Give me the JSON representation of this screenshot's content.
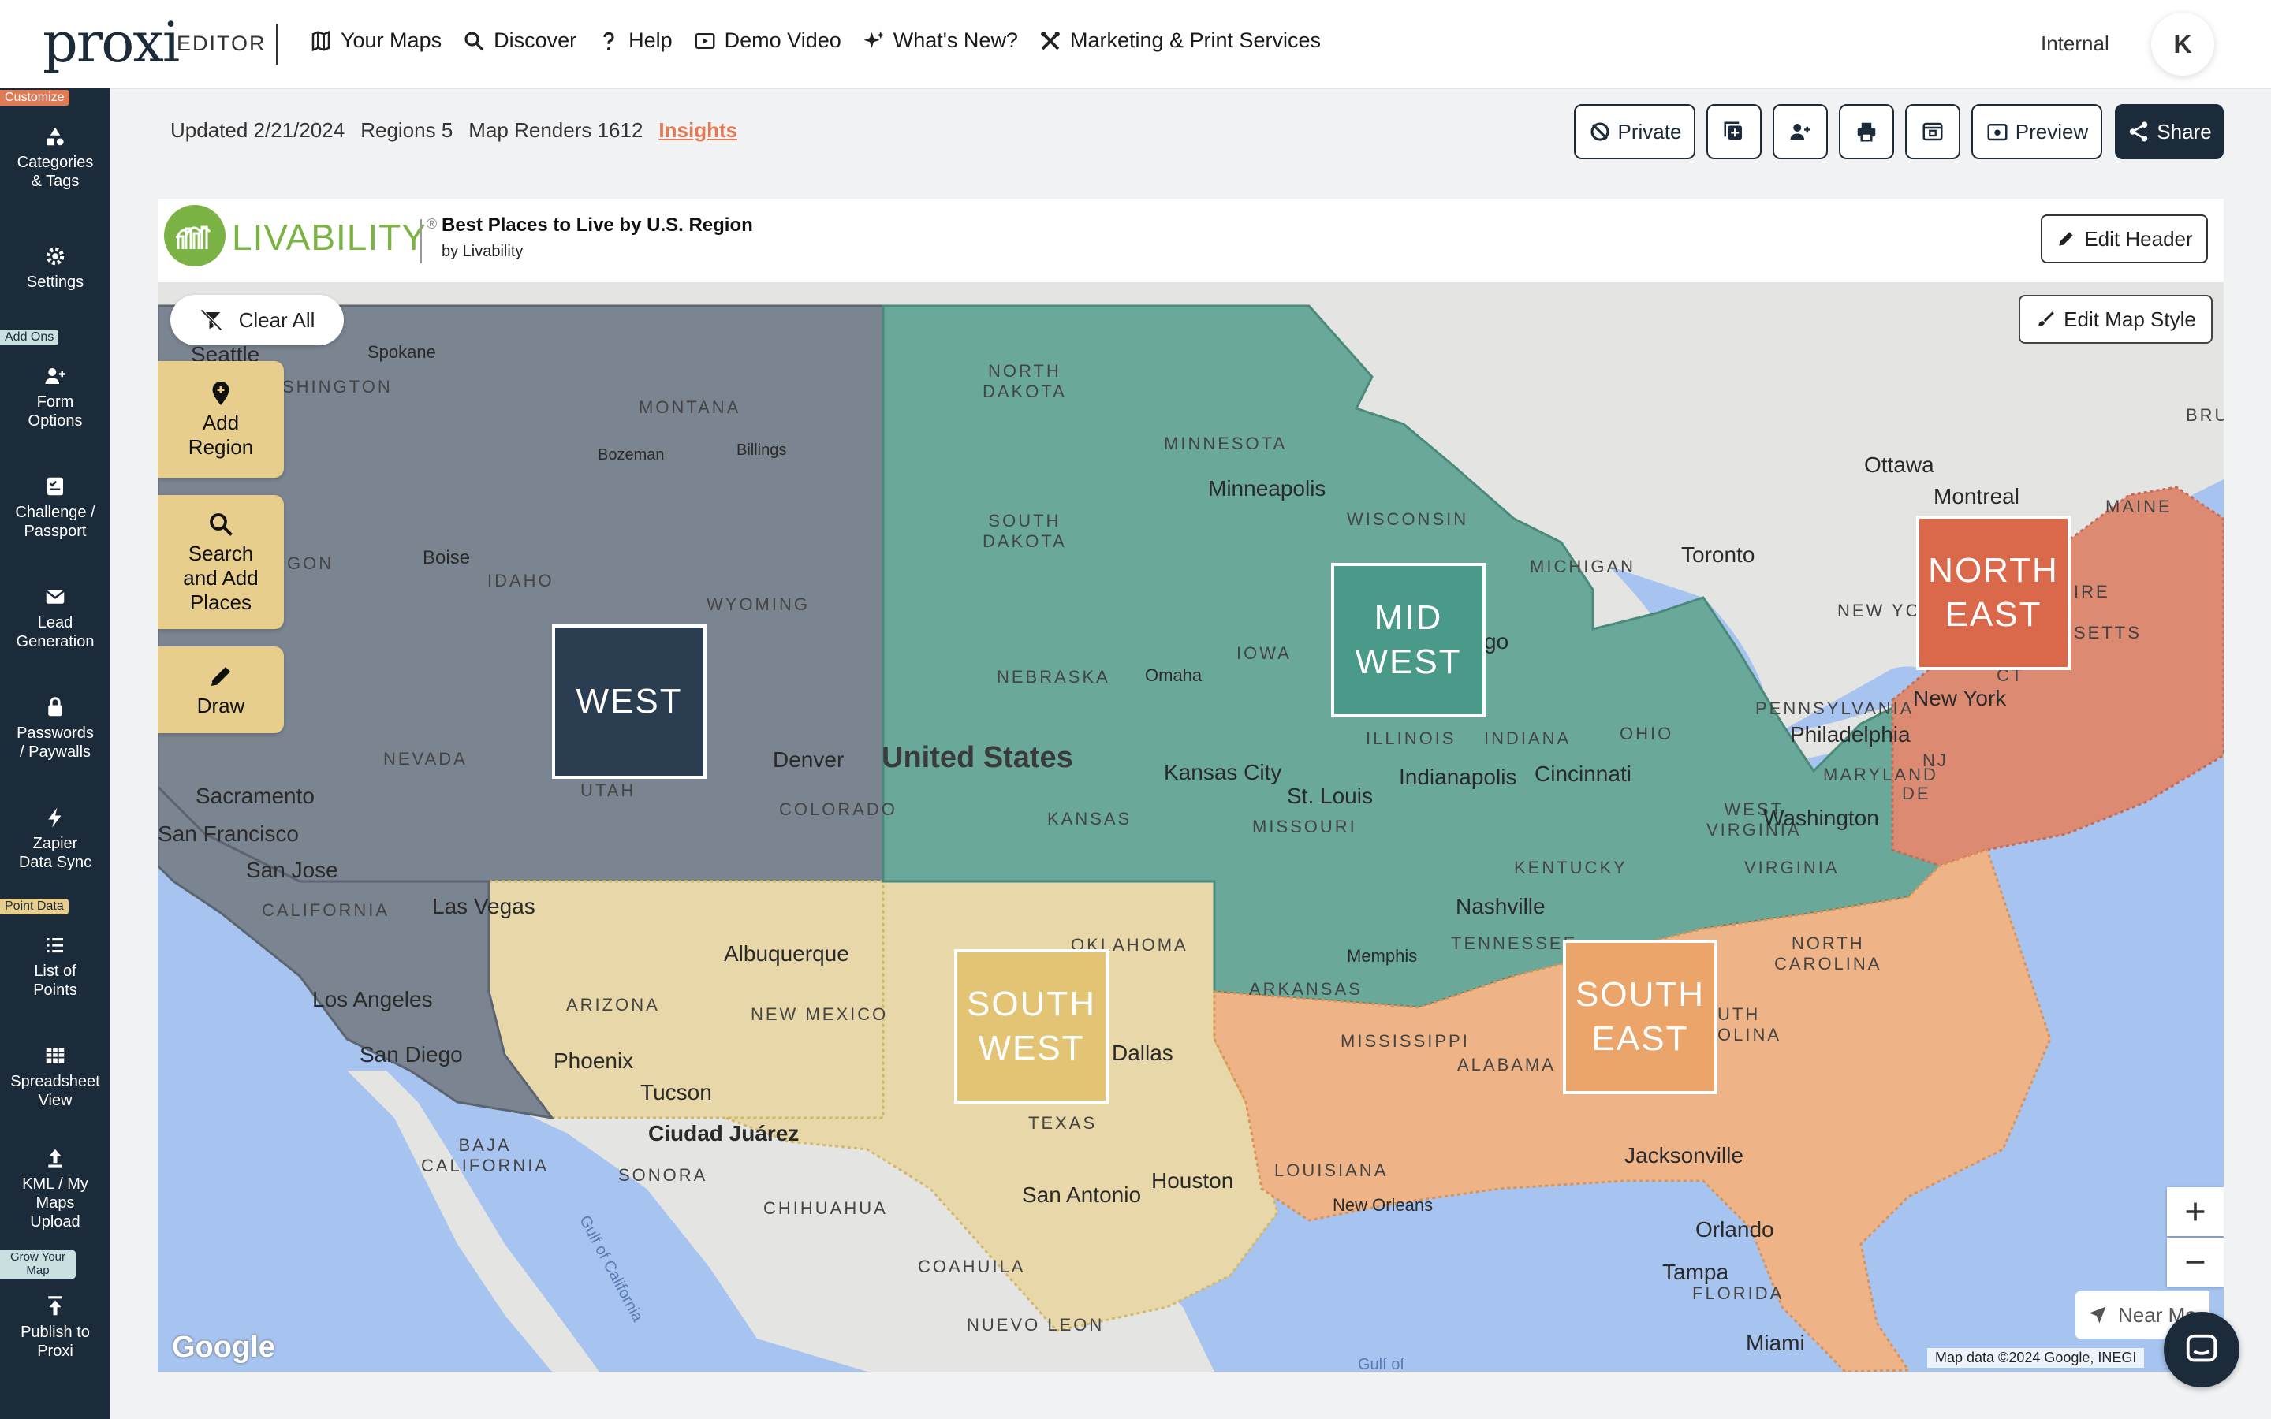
{
  "nav": {
    "logo": "proxi",
    "editor": "EDITOR",
    "items": [
      {
        "label": "Your Maps",
        "icon": "map-icon"
      },
      {
        "label": "Discover",
        "icon": "search-icon"
      },
      {
        "label": "Help",
        "icon": "question-icon"
      },
      {
        "label": "Demo Video",
        "icon": "play-icon"
      },
      {
        "label": "What's New?",
        "icon": "sparkle-icon"
      },
      {
        "label": "Marketing & Print Services",
        "icon": "tools-icon"
      }
    ],
    "internal": "Internal",
    "avatar": "K"
  },
  "sidebar": {
    "tags": [
      "Customize",
      "Add Ons",
      "Point Data",
      "Grow Your Map"
    ],
    "items": [
      {
        "label": "Categories\n& Tags",
        "icon": "shapes-icon"
      },
      {
        "label": "Settings",
        "icon": "gear-icon"
      },
      {
        "label": "Form\nOptions",
        "icon": "user-plus-icon"
      },
      {
        "label": "Challenge /\nPassport",
        "icon": "checklist-icon"
      },
      {
        "label": "Lead\nGeneration",
        "icon": "mail-icon"
      },
      {
        "label": "Passwords\n/ Paywalls",
        "icon": "lock-icon"
      },
      {
        "label": "Zapier\nData Sync",
        "icon": "bolt-icon"
      },
      {
        "label": "List of\nPoints",
        "icon": "list-icon"
      },
      {
        "label": "Spreadsheet\nView",
        "icon": "table-icon"
      },
      {
        "label": "KML / My\nMaps\nUpload",
        "icon": "upload-icon"
      },
      {
        "label": "Publish to\nProxi",
        "icon": "publish-icon"
      }
    ]
  },
  "stats": {
    "updated": "Updated 2/21/2024",
    "regions": "Regions 5",
    "renders": "Map Renders 1612",
    "insights": "Insights"
  },
  "toolbar": {
    "private": "Private",
    "preview": "Preview",
    "share": "Share"
  },
  "header": {
    "brand": "LIVABILITY",
    "brand_mark": "®",
    "title": "Best Places to Live by U.S. Region",
    "subtitle": "by Livability",
    "edit": "Edit Header"
  },
  "map": {
    "clear_all": "Clear All",
    "tools": [
      "Add\nRegion",
      "Search\nand Add\nPlaces",
      "Draw"
    ],
    "edit_style": "Edit Map Style",
    "near_me": "Near Me",
    "google": "Google",
    "attribution": "Map data ©2024 Google, INEGI",
    "regions": [
      {
        "label": "WEST",
        "color": "#2b3e51"
      },
      {
        "label": "MID\nWEST",
        "color": "#4a9a8a"
      },
      {
        "label": "NORTH\nEAST",
        "color": "#d9694a"
      },
      {
        "label": "SOUTH\nWEST",
        "color": "#e3c474"
      },
      {
        "label": "SOUTH\nEAST",
        "color": "#eba56a"
      }
    ],
    "labels": {
      "seattle": "Seattle",
      "spokane": "Spokane",
      "washington": "SHINGTON",
      "montana": "MONTANA",
      "bozeman": "Bozeman",
      "billings": "Billings",
      "oregon": "GON",
      "boise": "Boise",
      "idaho": "IDAHO",
      "wyoming": "WYOMING",
      "nevada": "NEVADA",
      "utah": "UTAH",
      "denver": "Denver",
      "colorado": "COLORADO",
      "united_states": "United States",
      "sacramento": "Sacramento",
      "san_francisco": "San Francisco",
      "san_jose": "San Jose",
      "california": "CALIFORNIA",
      "las_vegas": "Las Vegas",
      "los_angeles": "Los Angeles",
      "san_diego": "San Diego",
      "arizona": "ARIZONA",
      "phoenix": "Phoenix",
      "tucson": "Tucson",
      "albuquerque": "Albuquerque",
      "new_mexico": "NEW MEXICO",
      "ciudad_juarez": "Ciudad Juárez",
      "baja_california": "BAJA\nCALIFORNIA",
      "sonora": "SONORA",
      "chihuahua": "CHIHUAHUA",
      "coahuila": "COAHUILA",
      "nuevo_leon": "NUEVO LEON",
      "gulf_of_california": "Gulf of California",
      "north_dakota": "NORTH\nDAKOTA",
      "south_dakota": "SOUTH\nDAKOTA",
      "minnesota": "MINNESOTA",
      "minneapolis": "Minneapolis",
      "wisconsin": "WISCONSIN",
      "nebraska": "NEBRASKA",
      "omaha": "Omaha",
      "iowa": "IOWA",
      "kansas": "KANSAS",
      "kansas_city": "Kansas City",
      "missouri": "MISSOURI",
      "st_louis": "St. Louis",
      "illinois": "ILLINOIS",
      "indiana": "INDIANA",
      "indianapolis": "Indianapolis",
      "michigan": "MICHIGAN",
      "ohio": "OHIO",
      "cincinnati": "Cincinnati",
      "chicago": "go",
      "oklahoma": "OKLAHOMA",
      "texas": "TEXAS",
      "dallas": "Dallas",
      "houston": "Houston",
      "san_antonio": "San Antonio",
      "ottawa": "Ottawa",
      "montreal": "Montreal",
      "toronto": "Toronto",
      "maine": "MAINE",
      "bru": "BRU",
      "new_york_state": "NEW YO",
      "massachusetts": "SETTS",
      "ire": "IRE",
      "pennsylvania": "PENNSYLVANIA",
      "philadelphia": "Philadelphia",
      "new_york": "New York",
      "nj": "NJ",
      "ct": "CT",
      "maryland": "MARYLAND",
      "de": "DE",
      "west_virginia": "WEST\nVIRGINIA",
      "washington_dc": "Washington",
      "kentucky": "KENTUCKY",
      "virginia": "VIRGINIA",
      "nashville": "Nashville",
      "tennessee": "TENNESSEE",
      "memphis": "Memphis",
      "north_carolina": "NORTH\nCAROLINA",
      "south_carolina": "UTH\nOLINA",
      "arkansas": "ARKANSAS",
      "mississippi": "MISSISSIPPI",
      "alabama": "ALABAMA",
      "louisiana": "LOUISIANA",
      "new_orleans": "New Orleans",
      "jacksonville": "Jacksonville",
      "orlando": "Orlando",
      "tampa": "Tampa",
      "florida": "FLORIDA",
      "miami": "Miami",
      "gulf_of": "Gulf of"
    }
  }
}
